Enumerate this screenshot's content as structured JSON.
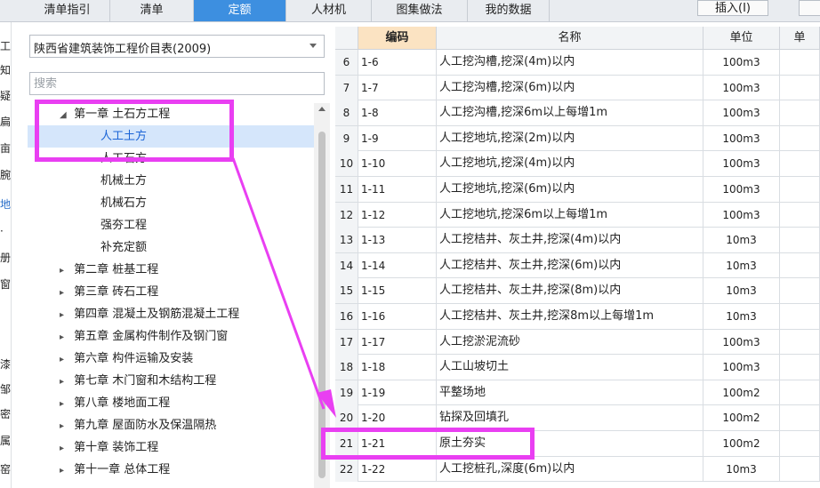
{
  "tabs": [
    {
      "label": "清单指引",
      "active": false
    },
    {
      "label": "清单",
      "active": false
    },
    {
      "label": "定额",
      "active": true
    },
    {
      "label": "人材机",
      "active": false
    },
    {
      "label": "图集做法",
      "active": false
    },
    {
      "label": "我的数据",
      "active": false
    }
  ],
  "toolbar": {
    "insert_label": "插入(I)"
  },
  "left_strip": {
    "chars": [
      "工",
      "知",
      "疑",
      "扁",
      "亩",
      "腕",
      "地",
      "·",
      "册",
      "窗",
      "漆",
      "邹",
      "密",
      "属",
      "窑"
    ]
  },
  "library": {
    "selected": "陕西省建筑装饰工程价目表(2009)"
  },
  "search": {
    "placeholder": "搜索"
  },
  "tree": {
    "chapter1": {
      "label": "第一章 土石方工程",
      "expanded": true
    },
    "children": [
      "人工土方",
      "人工石方",
      "机械土方",
      "机械石方",
      "强夯工程",
      "补充定额"
    ],
    "selected_child": "人工土方",
    "chapters": [
      "第二章 桩基工程",
      "第三章 砖石工程",
      "第四章 混凝土及钢筋混凝土工程",
      "第五章 金属构件制作及钢门窗",
      "第六章 构件运输及安装",
      "第七章 木门窗和木结构工程",
      "第八章 楼地面工程",
      "第九章 屋面防水及保温隔热",
      "第十章 装饰工程",
      "第十一章 总体工程"
    ]
  },
  "grid": {
    "headers": {
      "code": "编码",
      "name": "名称",
      "unit": "单位",
      "extra": "单"
    },
    "rows": [
      {
        "no": "6",
        "code": "1-6",
        "name": "人工挖沟槽,挖深(4m)以内",
        "unit": "100m3"
      },
      {
        "no": "7",
        "code": "1-7",
        "name": "人工挖沟槽,挖深(6m)以内",
        "unit": "100m3"
      },
      {
        "no": "8",
        "code": "1-8",
        "name": "人工挖沟槽,挖深6m以上每增1m",
        "unit": "100m3"
      },
      {
        "no": "9",
        "code": "1-9",
        "name": "人工挖地坑,挖深(2m)以内",
        "unit": "100m3"
      },
      {
        "no": "10",
        "code": "1-10",
        "name": "人工挖地坑,挖深(4m)以内",
        "unit": "100m3"
      },
      {
        "no": "11",
        "code": "1-11",
        "name": "人工挖地坑,挖深(6m)以内",
        "unit": "100m3"
      },
      {
        "no": "12",
        "code": "1-12",
        "name": "人工挖地坑,挖深6m以上每增1m",
        "unit": "100m3"
      },
      {
        "no": "13",
        "code": "1-13",
        "name": "人工挖桔井、灰土井,挖深(4m)以内",
        "unit": "10m3"
      },
      {
        "no": "14",
        "code": "1-14",
        "name": "人工挖桔井、灰土井,挖深(6m)以内",
        "unit": "10m3"
      },
      {
        "no": "15",
        "code": "1-15",
        "name": "人工挖桔井、灰土井,挖深(8m)以内",
        "unit": "10m3"
      },
      {
        "no": "16",
        "code": "1-16",
        "name": "人工挖桔井、灰土井,挖深8m以上每增1m",
        "unit": "10m3"
      },
      {
        "no": "17",
        "code": "1-17",
        "name": "人工挖淤泥流砂",
        "unit": "100m3"
      },
      {
        "no": "18",
        "code": "1-18",
        "name": "人工山坡切土",
        "unit": "100m3"
      },
      {
        "no": "19",
        "code": "1-19",
        "name": "平整场地",
        "unit": "100m2"
      },
      {
        "no": "20",
        "code": "1-20",
        "name": "钻探及回填孔",
        "unit": "100m2"
      },
      {
        "no": "21",
        "code": "1-21",
        "name": "原土夯实",
        "unit": "100m2"
      },
      {
        "no": "22",
        "code": "1-22",
        "name": "人工挖桩孔,深度(6m)以内",
        "unit": "10m3"
      }
    ]
  },
  "colors": {
    "accent": "#3d8fe0",
    "highlight": "#e93ff2",
    "code_header": "#fbe3c2",
    "selected_row": "#d5e6fb"
  }
}
